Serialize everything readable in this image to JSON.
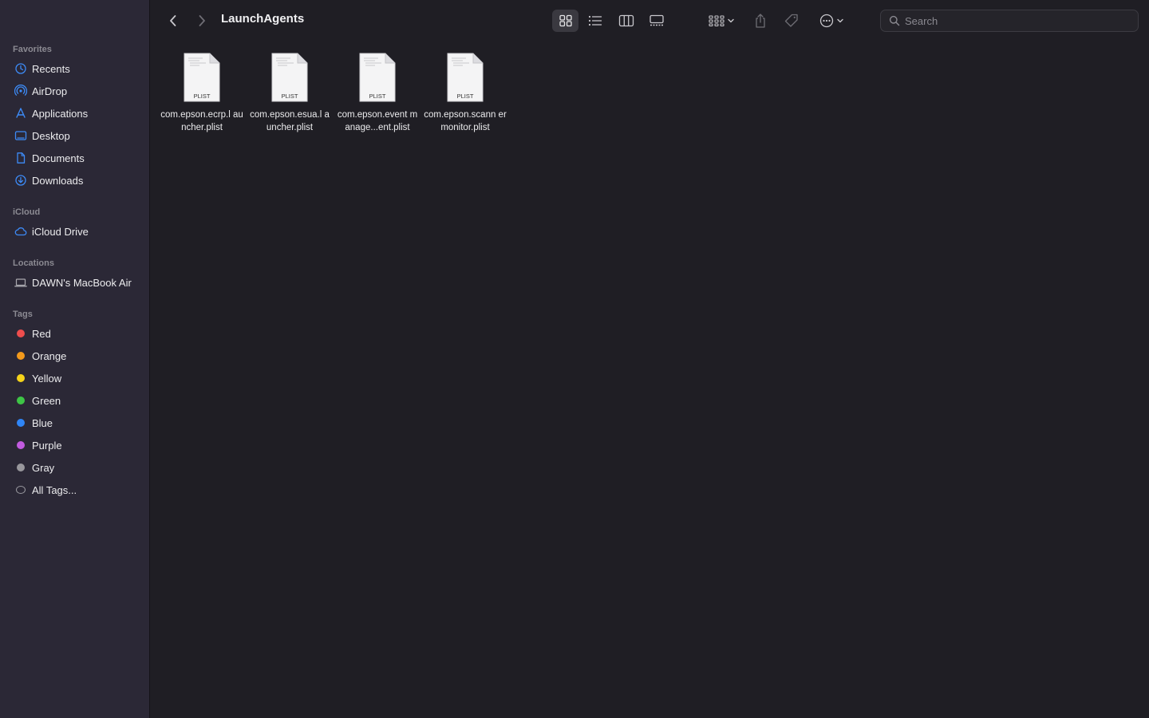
{
  "window": {
    "title": "LaunchAgents"
  },
  "sidebar": {
    "favorites_label": "Favorites",
    "favorites": [
      {
        "label": "Recents",
        "icon": "clock-icon"
      },
      {
        "label": "AirDrop",
        "icon": "airdrop-icon"
      },
      {
        "label": "Applications",
        "icon": "applications-icon"
      },
      {
        "label": "Desktop",
        "icon": "desktop-icon"
      },
      {
        "label": "Documents",
        "icon": "document-icon"
      },
      {
        "label": "Downloads",
        "icon": "download-icon"
      }
    ],
    "icloud_label": "iCloud",
    "icloud": [
      {
        "label": "iCloud Drive",
        "icon": "cloud-icon"
      }
    ],
    "locations_label": "Locations",
    "locations": [
      {
        "label": "DAWN's MacBook Air",
        "icon": "laptop-icon"
      }
    ],
    "tags_label": "Tags",
    "tags": [
      {
        "label": "Red",
        "color": "#ee4d4d"
      },
      {
        "label": "Orange",
        "color": "#f39a1c"
      },
      {
        "label": "Yellow",
        "color": "#f5d31a"
      },
      {
        "label": "Green",
        "color": "#3ec546"
      },
      {
        "label": "Blue",
        "color": "#2f85f6"
      },
      {
        "label": "Purple",
        "color": "#c25be0"
      },
      {
        "label": "Gray",
        "color": "#98979c"
      }
    ],
    "all_tags_label": "All Tags..."
  },
  "toolbar": {
    "search_placeholder": "Search",
    "active_view": "icon-view"
  },
  "files": [
    {
      "name": "com.epson.ecrp.launcher.plist",
      "display_name": "com.epson.ecrp.l auncher.plist",
      "badge": "PLIST"
    },
    {
      "name": "com.epson.esua.launcher.plist",
      "display_name": "com.epson.esua.l auncher.plist",
      "badge": "PLIST"
    },
    {
      "name": "com.epson.eventmanager.agent.plist",
      "display_name": "com.epson.event manage...ent.plist",
      "badge": "PLIST"
    },
    {
      "name": "com.epson.scannermonitor.plist",
      "display_name": "com.epson.scann ermonitor.plist",
      "badge": "PLIST"
    }
  ],
  "colors": {
    "accent": "#3d8bf7",
    "sidebar_bg": "#2b2836",
    "content_bg": "#1f1e24"
  }
}
